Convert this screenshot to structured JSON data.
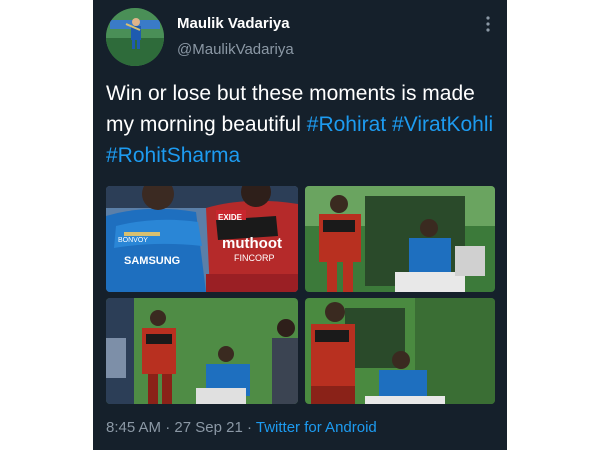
{
  "user": {
    "display_name": "Maulik Vadariya",
    "handle": "@MaulikVadariya"
  },
  "tweet": {
    "text_plain": "Win or lose but these moments is made my morning beautiful",
    "hashtags": [
      "#Rohirat",
      "#ViratKohli",
      "#RohitSharma"
    ]
  },
  "media": {
    "photo1": {
      "jersey_left_sponsor": "SAMSUNG",
      "jersey_left_chest": "BONVOY",
      "jersey_right_sponsor": "muthoot",
      "jersey_right_sub": "FINCORP",
      "jersey_right_top": "EXIDE"
    }
  },
  "footer": {
    "time": "8:45 AM",
    "date": "27 Sep 21",
    "app": "Twitter for Android",
    "separator": "·"
  },
  "icons": {
    "more": "more-vertical-icon"
  },
  "colors": {
    "background": "#15202b",
    "text": "#ffffff",
    "muted": "#8b98a5",
    "link": "#1d9bf0"
  }
}
